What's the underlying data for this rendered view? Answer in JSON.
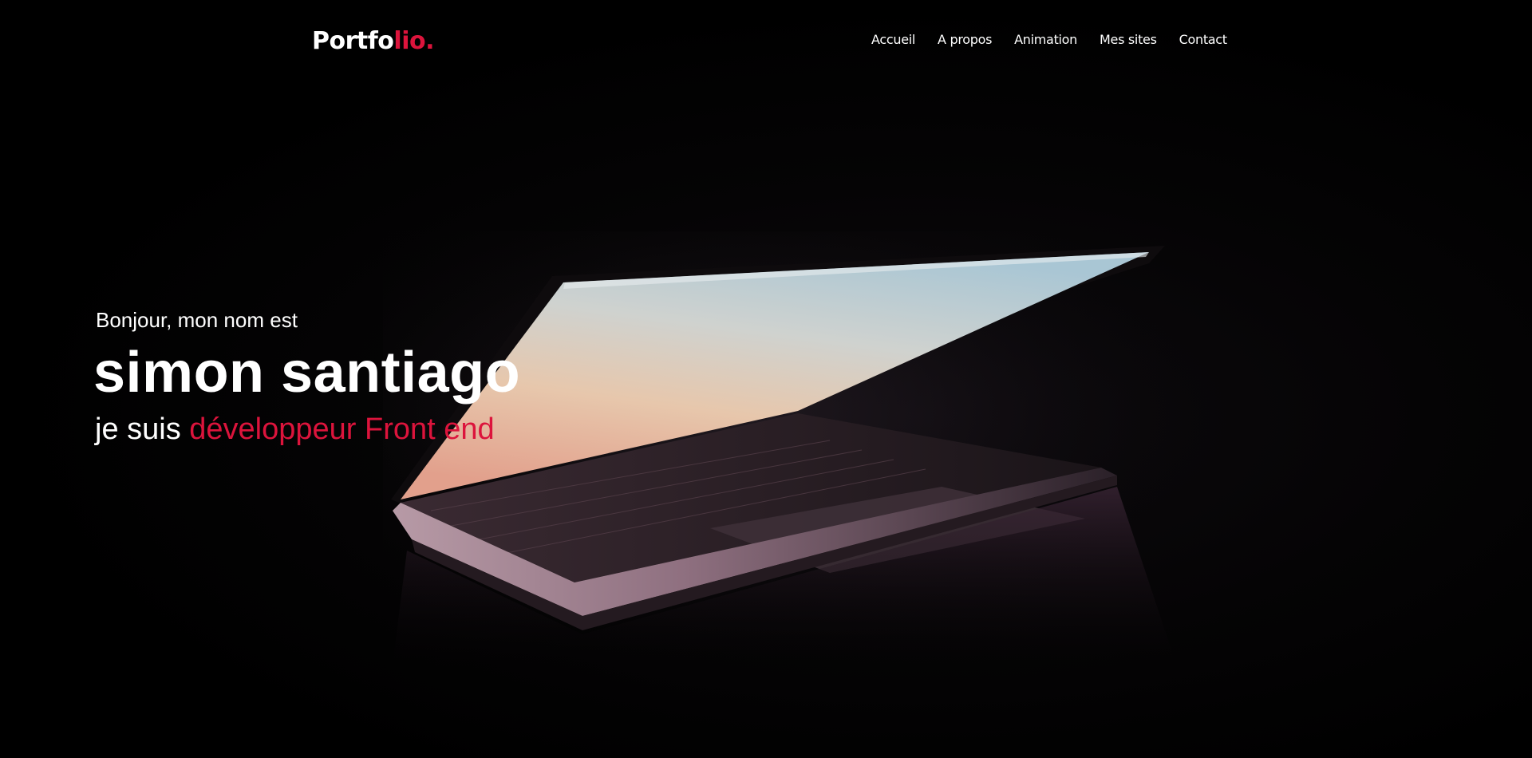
{
  "logo": {
    "main": "Portfo",
    "accent": "lio."
  },
  "nav": {
    "items": [
      {
        "label": "Accueil"
      },
      {
        "label": "A propos"
      },
      {
        "label": "Animation"
      },
      {
        "label": "Mes sites"
      },
      {
        "label": "Contact"
      }
    ]
  },
  "hero": {
    "greeting": "Bonjour, mon nom est",
    "name": "simon santiago",
    "role_prefix": "je suis ",
    "role_accent": "développeur Front end",
    "background_image": "laptop-photo"
  },
  "colors": {
    "accent": "#dc143c",
    "text": "#ffffff",
    "background": "#000000"
  }
}
